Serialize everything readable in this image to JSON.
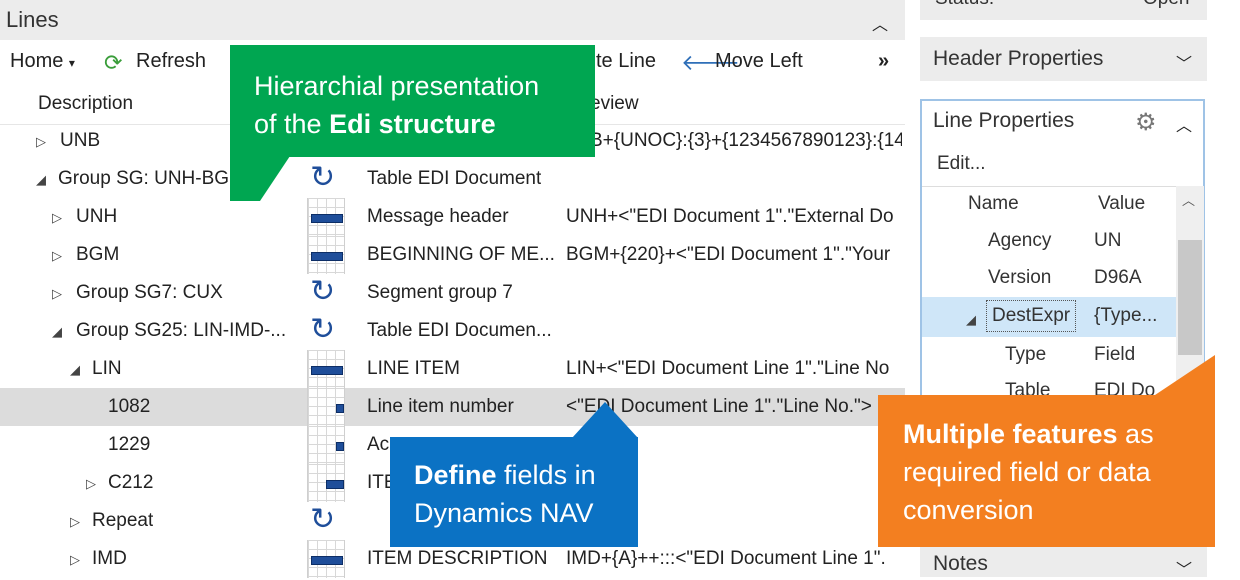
{
  "lines": {
    "title": "Lines",
    "collapse_icon": "chevron-up-icon"
  },
  "toolbar": {
    "home": "Home",
    "refresh": "Refresh",
    "line_partial": "te Line",
    "move_left": "Move Left",
    "more": "»"
  },
  "columns": {
    "description": "Description",
    "preview_partial": "eview"
  },
  "rows": [
    {
      "desc": "UNB",
      "arrow": "▷",
      "name": "",
      "preview": "B+{UNOC}:{3}+{1234567890123}:{14"
    },
    {
      "desc": "Group SG: UNH-BGM-...",
      "arrow": "◢",
      "name": "Table EDI Document",
      "preview": ""
    },
    {
      "desc": "UNH",
      "arrow": "▷",
      "name": "Message header",
      "preview": "UNH+<\"EDI Document 1\".\"External Do"
    },
    {
      "desc": "BGM",
      "arrow": "▷",
      "name": "BEGINNING OF ME...",
      "preview": "BGM+{220}+<\"EDI Document 1\".\"Your"
    },
    {
      "desc": "Group SG7: CUX",
      "arrow": "▷",
      "name": "Segment group 7",
      "preview": ""
    },
    {
      "desc": "Group SG25: LIN-IMD-...",
      "arrow": "◢",
      "name": "Table EDI Documen...",
      "preview": ""
    },
    {
      "desc": "LIN",
      "arrow": "◢",
      "name": "LINE ITEM",
      "preview": "LIN+<\"EDI Document Line 1\".\"Line No"
    },
    {
      "desc": "1082",
      "arrow": "",
      "name": "Line item number",
      "preview": "<\"EDI Document Line 1\".\"Line No.\">"
    },
    {
      "desc": "1229",
      "arrow": "",
      "name": "Ac",
      "preview": ""
    },
    {
      "desc": "C212",
      "arrow": "▷",
      "name": "ITE",
      "preview": ""
    },
    {
      "desc": "Repeat",
      "arrow": "▷",
      "name": "",
      "preview": ""
    },
    {
      "desc": "IMD",
      "arrow": "▷",
      "name": "ITEM DESCRIPTION",
      "preview": "IMD+{A}++:::<\"EDI Document Line 1\"."
    }
  ],
  "right_panel": {
    "status_label": "Status:",
    "status_value": "Open",
    "header_properties": "Header Properties",
    "line_properties": "Line Properties",
    "edit": "Edit...",
    "name_col": "Name",
    "value_col": "Value",
    "props": [
      {
        "name": "Agency",
        "value": "UN"
      },
      {
        "name": "Version",
        "value": "D96A"
      },
      {
        "name": "DestExpr",
        "value": "{Type..."
      },
      {
        "name": "Type",
        "value": "Field"
      },
      {
        "name": "Table",
        "value": "EDI Do"
      }
    ],
    "notes": "Notes"
  },
  "callouts": {
    "green_line1": "Hierarchial presentation",
    "green_line2_pre": "of the ",
    "green_line2_bold": "Edi structure",
    "blue_bold": "Define",
    "blue_rest": " fields in",
    "blue_line2": "Dynamics NAV",
    "orange_bold": "Multiple features",
    "orange_rest": " as",
    "orange_line2": "required field or data",
    "orange_line3": "conversion"
  },
  "colors": {
    "green": "#00a651",
    "blue": "#0b72c4",
    "orange": "#f37f20",
    "icon_blue": "#1f4e9a"
  }
}
